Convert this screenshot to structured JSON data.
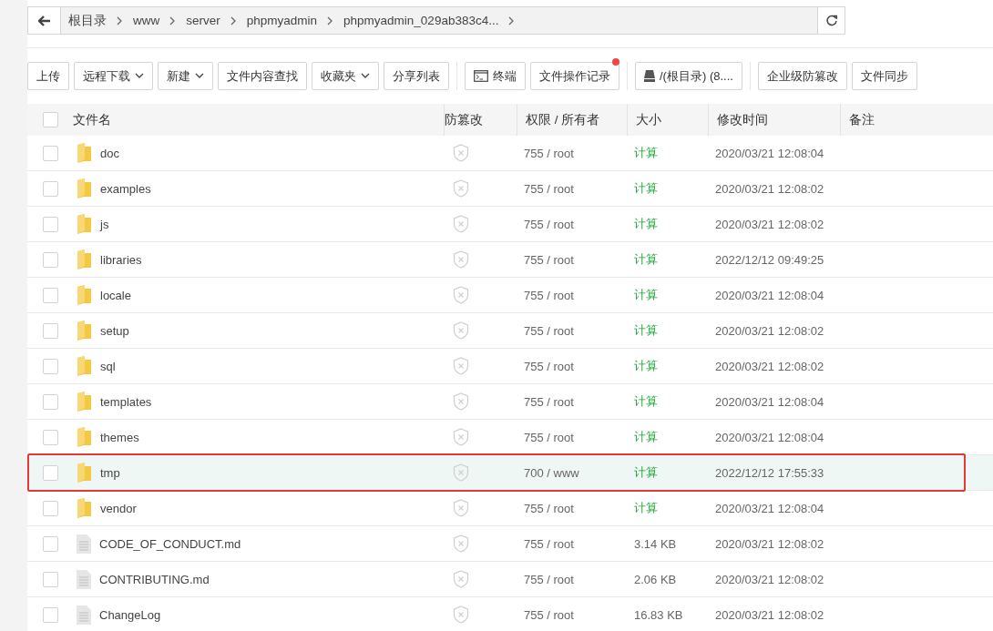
{
  "breadcrumb": {
    "items": [
      "根目录",
      "www",
      "server",
      "phpmyadmin",
      "phpmyadmin_029ab383c4..."
    ]
  },
  "toolbar": [
    {
      "label": "上传",
      "kind": "plain",
      "dropdown": false,
      "notification": false
    },
    {
      "label": "远程下载",
      "kind": "plain",
      "dropdown": true,
      "notification": false
    },
    {
      "label": "新建",
      "kind": "plain",
      "dropdown": true,
      "notification": false
    },
    {
      "label": "文件内容查找",
      "kind": "plain",
      "dropdown": false,
      "notification": false
    },
    {
      "label": "收藏夹",
      "kind": "plain",
      "dropdown": true,
      "notification": false
    },
    {
      "label": "分享列表",
      "kind": "plain",
      "dropdown": false,
      "notification": false
    },
    {
      "label": "终端",
      "kind": "terminal",
      "dropdown": false,
      "notification": false
    },
    {
      "label": "文件操作记录",
      "kind": "plain",
      "dropdown": false,
      "notification": true
    },
    {
      "label": "/(根目录) (8....",
      "kind": "disk",
      "dropdown": false,
      "notification": false
    },
    {
      "label": "企业级防篡改",
      "kind": "plain",
      "dropdown": false,
      "notification": false
    },
    {
      "label": "文件同步",
      "kind": "plain",
      "dropdown": false,
      "notification": false
    }
  ],
  "table": {
    "select_all_checked": false,
    "columns": [
      "文件名",
      "防篡改",
      "权限 / 所有者",
      "大小",
      "修改时间",
      "备注"
    ],
    "rows": [
      {
        "name": "doc",
        "kind": "folder",
        "permission": "755 / root",
        "size": "计算",
        "modified": "2020/03/21 12:08:04",
        "checked": false,
        "selected": false
      },
      {
        "name": "examples",
        "kind": "folder",
        "permission": "755 / root",
        "size": "计算",
        "modified": "2020/03/21 12:08:02",
        "checked": false,
        "selected": false
      },
      {
        "name": "js",
        "kind": "folder",
        "permission": "755 / root",
        "size": "计算",
        "modified": "2020/03/21 12:08:02",
        "checked": false,
        "selected": false
      },
      {
        "name": "libraries",
        "kind": "folder",
        "permission": "755 / root",
        "size": "计算",
        "modified": "2022/12/12 09:49:25",
        "checked": false,
        "selected": false
      },
      {
        "name": "locale",
        "kind": "folder",
        "permission": "755 / root",
        "size": "计算",
        "modified": "2020/03/21 12:08:04",
        "checked": false,
        "selected": false
      },
      {
        "name": "setup",
        "kind": "folder",
        "permission": "755 / root",
        "size": "计算",
        "modified": "2020/03/21 12:08:02",
        "checked": false,
        "selected": false
      },
      {
        "name": "sql",
        "kind": "folder",
        "permission": "755 / root",
        "size": "计算",
        "modified": "2020/03/21 12:08:02",
        "checked": false,
        "selected": false
      },
      {
        "name": "templates",
        "kind": "folder",
        "permission": "755 / root",
        "size": "计算",
        "modified": "2020/03/21 12:08:04",
        "checked": false,
        "selected": false
      },
      {
        "name": "themes",
        "kind": "folder",
        "permission": "755 / root",
        "size": "计算",
        "modified": "2020/03/21 12:08:04",
        "checked": false,
        "selected": false
      },
      {
        "name": "tmp",
        "kind": "folder",
        "permission": "700 / www",
        "size": "计算",
        "modified": "2022/12/12 17:55:33",
        "checked": false,
        "selected": true
      },
      {
        "name": "vendor",
        "kind": "folder",
        "permission": "755 / root",
        "size": "计算",
        "modified": "2020/03/21 12:08:04",
        "checked": false,
        "selected": false
      },
      {
        "name": "CODE_OF_CONDUCT.md",
        "kind": "file",
        "permission": "755 / root",
        "size": "3.14 KB",
        "modified": "2020/03/21 12:08:02",
        "checked": false,
        "selected": false
      },
      {
        "name": "CONTRIBUTING.md",
        "kind": "file",
        "permission": "755 / root",
        "size": "2.06 KB",
        "modified": "2020/03/21 12:08:02",
        "checked": false,
        "selected": false
      },
      {
        "name": "ChangeLog",
        "kind": "file",
        "permission": "755 / root",
        "size": "16.83 KB",
        "modified": "2020/03/21 12:08:02",
        "checked": false,
        "selected": false
      }
    ]
  }
}
